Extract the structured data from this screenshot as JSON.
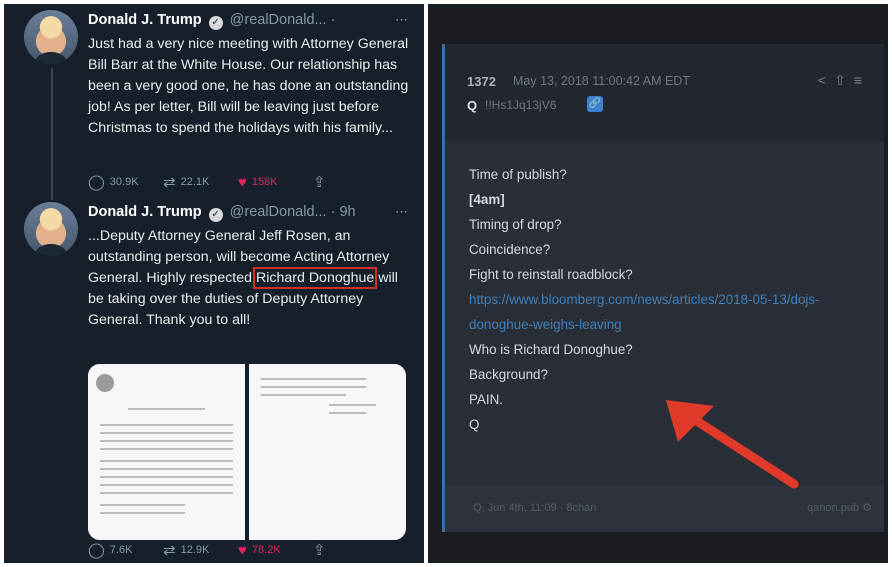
{
  "tweets": [
    {
      "name": "Donald J. Trump",
      "handle": "@realDonald...",
      "time": "",
      "text": "Just had a very nice meeting with Attorney General Bill Barr at the White House. Our relationship has been a very good one, he has done an outstanding job! As per letter, Bill will be leaving just before Christmas to spend the holidays with his family...",
      "replies": "30.9K",
      "retweets": "22.1K",
      "likes": "158K"
    },
    {
      "name": "Donald J. Trump",
      "handle": "@realDonald...",
      "time": "9h",
      "text_before": "...Deputy Attorney General Jeff Rosen, an outstanding person, will become Acting Attorney General. Highly respected ",
      "text_highlight": "Richard Donoghue",
      "text_after": " will be taking over the duties of Deputy Attorney General. Thank you to all!",
      "replies": "7.6K",
      "retweets": "12.9K",
      "likes": "78.2K"
    }
  ],
  "post": {
    "id": "1372",
    "date": "May 13, 2018 11:00:42 AM EDT",
    "author": "Q",
    "tripcode": "!!Hs1Jq13jV6",
    "lines_top": [
      "Time of publish?",
      "[4am]",
      "Timing of drop?",
      "Coincidence?",
      "Fight to reinstall roadblock?"
    ],
    "link": "https://www.bloomberg.com/news/articles/2018-05-13/dojs-donoghue-weighs-leaving",
    "lines_bottom": [
      "Who is Richard Donoghue?",
      "Background?",
      "PAIN.",
      "Q"
    ],
    "footer_left": "Q, Jun 4th, 11:09 · 8chan",
    "footer_right": "qanon.pub"
  },
  "colors": {
    "tweet_bg": "#15202b",
    "like": "#e0245e",
    "highlight_box": "#d0302a",
    "arrow": "#e23a2a",
    "link": "#3f7fb8"
  }
}
